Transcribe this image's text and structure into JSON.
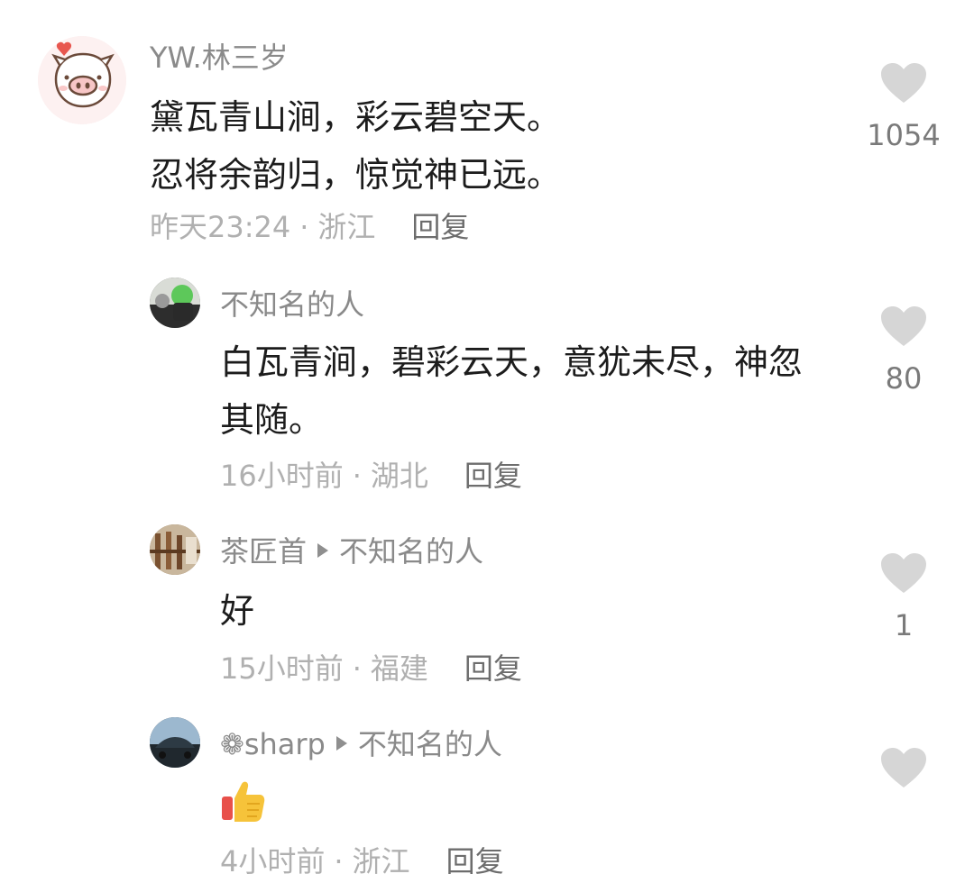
{
  "comments": [
    {
      "user": "YW.林三岁",
      "lines": [
        "黛瓦青山涧，彩云碧空天。",
        "忍将余韵归，惊觉神已远。"
      ],
      "time": "昨天23:24",
      "location": "浙江",
      "reply": "回复",
      "likes": "1054",
      "avatar": "pig-avatar"
    },
    {
      "user": "不知名的人",
      "lines": [
        "白瓦青涧，碧彩云天，意犹未尽，神忽",
        "其随。"
      ],
      "time": "16小时前",
      "location": "湖北",
      "reply": "回复",
      "likes": "80",
      "avatar": "green-figure-avatar"
    },
    {
      "user": "茶匠首",
      "reply_to": "不知名的人",
      "lines": [
        "好"
      ],
      "time": "15小时前",
      "location": "福建",
      "reply": "回复",
      "likes": "1",
      "avatar": "wood-shelf-avatar"
    },
    {
      "user": "❁sharp",
      "reply_to": "不知名的人",
      "content_icon": "thumbs-up-emoji",
      "time": "4小时前",
      "location": "浙江",
      "reply": "回复",
      "likes": "",
      "avatar": "car-avatar"
    }
  ],
  "colors": {
    "username": "#8a8a8a",
    "text": "#1c1c1c",
    "meta": "#b0b0b0",
    "heart": "#d6d6d6"
  }
}
